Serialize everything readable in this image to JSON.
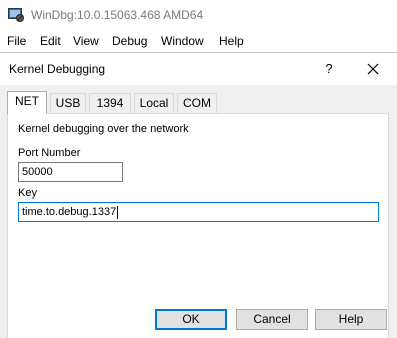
{
  "app": {
    "title": "WinDbg:10.0.15063.468 AMD64",
    "icon": "windbg-app-icon"
  },
  "menu": [
    "File",
    "Edit",
    "View",
    "Debug",
    "Window",
    "Help"
  ],
  "dialog": {
    "title": "Kernel Debugging",
    "help_glyph": "?",
    "tabs": [
      {
        "label": "NET",
        "active": true
      },
      {
        "label": "USB",
        "active": false
      },
      {
        "label": "1394",
        "active": false
      },
      {
        "label": "Local",
        "active": false
      },
      {
        "label": "COM",
        "active": false
      }
    ],
    "net": {
      "description": "Kernel debugging over the network",
      "port_label": "Port Number",
      "port_value": "50000",
      "key_label": "Key",
      "key_value": "time.to.debug.1337"
    },
    "buttons": {
      "ok": "OK",
      "cancel": "Cancel",
      "help": "Help"
    }
  },
  "colors": {
    "focus_border": "#0078d7",
    "dialog_bg": "#f0f0f0",
    "title_gray": "#7a7a7a"
  }
}
